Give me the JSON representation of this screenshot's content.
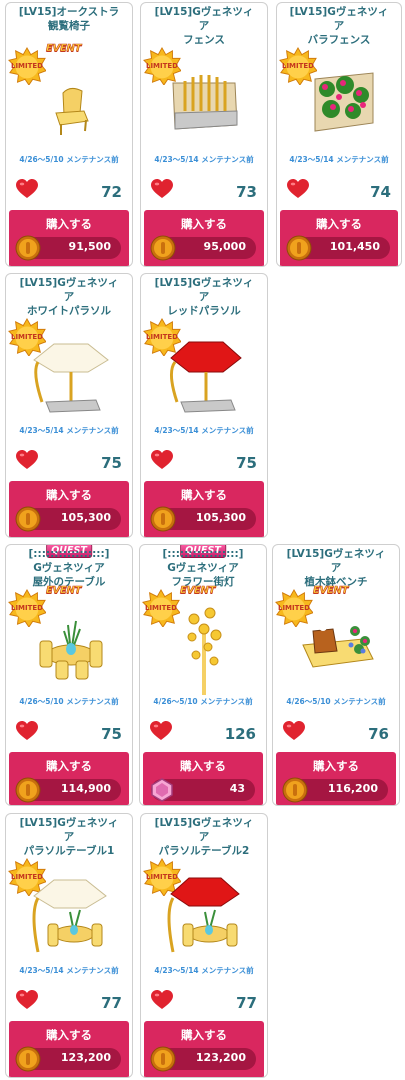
{
  "items": [
    {
      "title_line1": "[LV15]オークストラ",
      "title_line2": "観覧椅子",
      "badge": "EVENT",
      "period": "4/26～5/10 メンテナンス前",
      "likes": "72",
      "buy_label": "購入する",
      "price": "91,500",
      "currency_icon": "gold-coin-icon",
      "item_icon": "chair-icon"
    },
    {
      "title_line1": "[LV15]Gヴェネツィ",
      "title_line2": "ア\nフェンス",
      "badge": "",
      "period": "4/23～5/14 メンテナンス前",
      "likes": "73",
      "buy_label": "購入する",
      "price": "95,000",
      "currency_icon": "gold-coin-icon",
      "item_icon": "fence-icon"
    },
    {
      "title_line1": "[LV15]Gヴェネツィ",
      "title_line2": "ア\nバラフェンス",
      "badge": "",
      "period": "4/23～5/14 メンテナンス前",
      "likes": "74",
      "buy_label": "購入する",
      "price": "101,450",
      "currency_icon": "gold-coin-icon",
      "item_icon": "rose-fence-icon"
    },
    {
      "title_line1": "[LV15]Gヴェネツィ",
      "title_line2": "ア\nホワイトパラソル",
      "badge": "",
      "period": "4/23～5/14 メンテナンス前",
      "likes": "75",
      "buy_label": "購入する",
      "price": "105,300",
      "currency_icon": "gold-coin-icon",
      "item_icon": "white-parasol-icon"
    },
    {
      "title_line1": "[LV15]Gヴェネツィ",
      "title_line2": "ア\nレッドパラソル",
      "badge": "",
      "period": "4/23～5/14 メンテナンス前",
      "likes": "75",
      "buy_label": "購入する",
      "price": "105,300",
      "currency_icon": "gold-coin-icon",
      "item_icon": "red-parasol-icon"
    },
    {
      "title_line1": "[:::::::::::::::::]",
      "title_line2": "Gヴェネツィア\n屋外のテーブル",
      "badge": "EVENT",
      "quest": "QUEST",
      "period": "4/26～5/10 メンテナンス前",
      "likes": "75",
      "buy_label": "購入する",
      "price": "114,900",
      "currency_icon": "gold-coin-icon",
      "item_icon": "outdoor-table-icon"
    },
    {
      "title_line1": "[:::::::::::::::::]",
      "title_line2": "Gヴェネツィア\nフラワー街灯",
      "badge": "EVENT",
      "quest": "QUEST",
      "period": "4/26～5/10 メンテナンス前",
      "likes": "126",
      "buy_label": "購入する",
      "price": "43",
      "currency_icon": "pink-gem-icon",
      "item_icon": "flower-streetlamp-icon"
    },
    {
      "title_line1": "[LV15]Gヴェネツィ",
      "title_line2": "ア\n植木鉢ベンチ",
      "badge": "EVENT",
      "period": "4/26～5/10 メンテナンス前",
      "likes": "76",
      "buy_label": "購入する",
      "price": "116,200",
      "currency_icon": "gold-coin-icon",
      "item_icon": "planter-bench-icon"
    },
    {
      "title_line1": "[LV15]Gヴェネツィ",
      "title_line2": "ア\nパラソルテーブル1",
      "badge": "",
      "period": "4/23～5/14 メンテナンス前",
      "likes": "77",
      "buy_label": "購入する",
      "price": "123,200",
      "currency_icon": "gold-coin-icon",
      "item_icon": "parasol-table-white-icon"
    },
    {
      "title_line1": "[LV15]Gヴェネツィ",
      "title_line2": "ア\nパラソルテーブル2",
      "badge": "",
      "period": "4/23～5/14 メンテナンス前",
      "likes": "77",
      "buy_label": "購入する",
      "price": "123,200",
      "currency_icon": "gold-coin-icon",
      "item_icon": "parasol-table-red-icon"
    }
  ],
  "limited_label": "LIMITED",
  "colors": {
    "accent": "#d9275f",
    "price_bar": "#a51642",
    "title": "#2c6e7c",
    "period": "#3b8fd6",
    "heart": "#e0232f",
    "coin": "#e8a11c"
  }
}
